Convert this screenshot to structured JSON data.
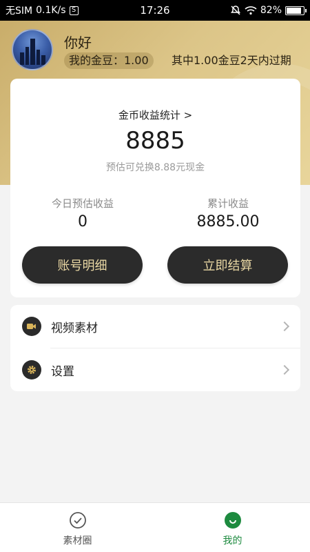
{
  "status_bar": {
    "carrier": "无SIM",
    "speed": "0.1K/s",
    "s_badge": "S",
    "time": "17:26",
    "battery": "82%",
    "icons": [
      "alarm-muted-icon",
      "wifi-icon",
      "battery-icon"
    ]
  },
  "profile": {
    "greeting": "你好",
    "beans_label": "我的金豆：1.00",
    "expire_note": "其中1.00金豆2天内过期"
  },
  "earnings": {
    "stats_link": "金币收益统计  >",
    "total": "8885",
    "estimate": "预估可兑换8.88元现金",
    "today_label": "今日预估收益",
    "today_value": "0",
    "cumulative_label": "累计收益",
    "cumulative_value": "8885.00",
    "account_button": "账号明细",
    "settle_button": "立即结算"
  },
  "menu": {
    "items": [
      {
        "label": "视频素材",
        "icon": "video-camera-icon"
      },
      {
        "label": "设置",
        "icon": "gear-icon"
      }
    ]
  },
  "tabbar": {
    "tabs": [
      {
        "label": "素材圈",
        "icon": "check-circle-icon",
        "active": false
      },
      {
        "label": "我的",
        "icon": "smile-icon",
        "active": true
      }
    ]
  },
  "colors": {
    "header_gold": "#dcc588",
    "button_dark": "#2b2b2b",
    "button_text": "#ead8a4",
    "active_tab": "#1d8a3f"
  }
}
